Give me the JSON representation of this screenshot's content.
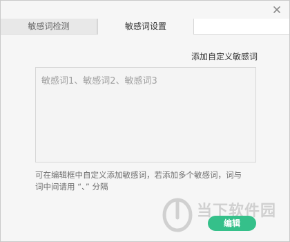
{
  "window": {
    "close_icon": "close-icon"
  },
  "tabs": [
    {
      "label": "敏感词检测",
      "active": false
    },
    {
      "label": "敏感词设置",
      "active": true
    }
  ],
  "settings": {
    "add_custom_label": "添加自定义敏感词",
    "editor_value": "敏感词1、敏感词2、敏感词3",
    "hint_line1": "可在编辑框中自定义添加敏感词，若添加多个敏感词，词与",
    "hint_line2": "词中间请用 “、” 分隔",
    "edit_button_label": "编辑"
  },
  "watermark": {
    "text": "当下软件园"
  },
  "colors": {
    "accent": "#35c08a",
    "background": "#f6f6f6",
    "border": "#d6d6d6"
  }
}
